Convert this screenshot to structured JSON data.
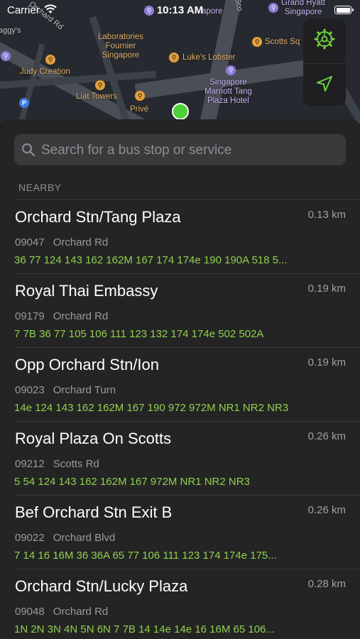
{
  "status_bar": {
    "carrier": "Carrier",
    "time": "10:13 AM"
  },
  "map": {
    "labels": {
      "aggys": "aggy's",
      "orchard_rd": "Orchard Rd",
      "laboratories": "Laboratories\nFournier\nSingapore",
      "lukes": "Luke's Lobster",
      "judy": "Judy Creation",
      "liat": "Liat Towers",
      "prive": "Privé",
      "marriott": "Singapore\nMarriott Tang\nPlaza Hotel",
      "scotts": "Scotts Sq",
      "grand_hyatt": "Grand Hyatt\nSingapore",
      "apore": "apore",
      "sco": "Sco"
    },
    "accent_color": "#4cd137"
  },
  "controls": {
    "settings_icon": "gear-icon",
    "locate_icon": "location-arrow-icon",
    "icon_color": "#6ccf3f"
  },
  "search": {
    "placeholder": "Search for a bus stop or service"
  },
  "section_title": "NEARBY",
  "stops": [
    {
      "name": "Orchard Stn/Tang Plaza",
      "distance": "0.13 km",
      "code": "09047",
      "road": "Orchard Rd",
      "services": "36  77  124  143  162  162M  167  174  174e  190  190A  518  5..."
    },
    {
      "name": "Royal Thai Embassy",
      "distance": "0.19 km",
      "code": "09179",
      "road": "Orchard Rd",
      "services": "7  7B  36  77  105  106  111  123  132  174  174e  502  502A"
    },
    {
      "name": "Opp Orchard Stn/Ion",
      "distance": "0.19 km",
      "code": "09023",
      "road": "Orchard Turn",
      "services": "14e  124  143  162  162M  167  190  972  972M  NR1  NR2  NR3"
    },
    {
      "name": "Royal Plaza On Scotts",
      "distance": "0.26 km",
      "code": "09212",
      "road": "Scotts Rd",
      "services": "5  54  124  143  162  162M  167  972M  NR1  NR2  NR3"
    },
    {
      "name": "Bef Orchard Stn Exit B",
      "distance": "0.26 km",
      "code": "09022",
      "road": "Orchard Blvd",
      "services": "7  14  16  16M  36  36A  65  77  106  111  123  174  174e  175..."
    },
    {
      "name": "Orchard Stn/Lucky Plaza",
      "distance": "0.28 km",
      "code": "09048",
      "road": "Orchard Rd",
      "services": "1N  2N  3N  4N  5N  6N  7  7B  14  14e  14e  16  16M  65  106..."
    }
  ]
}
